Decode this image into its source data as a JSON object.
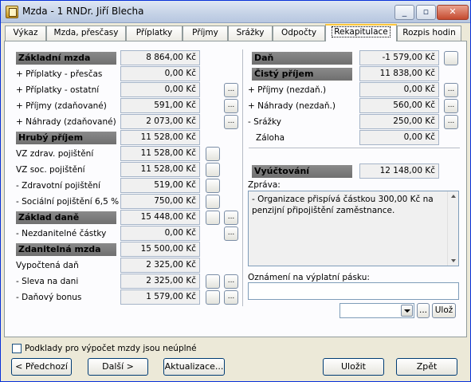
{
  "window": {
    "title": "Mzda - 1 RNDr. Jiří Blecha",
    "minimize": "_",
    "restore": "▫",
    "close": "✕"
  },
  "tabs": [
    "Výkaz",
    "Mzda, přesčasy",
    "Příplatky",
    "Příjmy",
    "Srážky",
    "Odpočty",
    "Rekapitulace",
    "Rozpis hodin"
  ],
  "active_tab": "Rekapitulace",
  "left": {
    "zakladni_mzda": {
      "label": "Základní mzda",
      "value": "8 864,00 Kč"
    },
    "priplatky_prescas": {
      "label": "+ Příplatky - přesčas",
      "value": "0,00 Kč"
    },
    "priplatky_ostatni": {
      "label": "+ Příplatky - ostatní",
      "value": "0,00 Kč"
    },
    "prijmy_zdanovane": {
      "label": "+ Příjmy (zdaňované)",
      "value": "591,00 Kč"
    },
    "nahrady_zdanovane": {
      "label": "+ Náhrady (zdaňované)",
      "value": "2 073,00 Kč"
    },
    "hruby_prijem": {
      "label": "Hrubý příjem",
      "value": "11 528,00 Kč"
    },
    "vz_zdrav": {
      "label": "VZ zdrav. pojištění",
      "value": "11 528,00 Kč"
    },
    "vz_soc": {
      "label": "VZ soc. pojištění",
      "value": "11 528,00 Kč"
    },
    "zdravotni": {
      "label": "- Zdravotní pojištění",
      "value": "519,00 Kč"
    },
    "socialni": {
      "label": "- Sociální pojištění 6,5 %",
      "value": "750,00 Kč"
    },
    "zaklad_dane": {
      "label": "Základ daně",
      "value": "15 448,00 Kč"
    },
    "nezdanitelne": {
      "label": "- Nezdanitelné částky",
      "value": "0,00 Kč"
    },
    "zdanitelna_mzda": {
      "label": "Zdanitelná mzda",
      "value": "15 500,00 Kč"
    },
    "vypoctena_dan": {
      "label": "Vypočtená daň",
      "value": "2 325,00 Kč"
    },
    "sleva_na_dani": {
      "label": "- Sleva na dani",
      "value": "2 325,00 Kč"
    },
    "danovy_bonus": {
      "label": "- Daňový bonus",
      "value": "1 579,00 Kč"
    }
  },
  "right": {
    "dan": {
      "label": "Daň",
      "value": "-1 579,00 Kč"
    },
    "cisty_prijem": {
      "label": "Čistý příjem",
      "value": "11 838,00 Kč"
    },
    "prijmy_nezdan": {
      "label": "+ Příjmy (nezdaň.)",
      "value": "0,00 Kč"
    },
    "nahrady_nezdan": {
      "label": "+ Náhrady (nezdaň.)",
      "value": "560,00 Kč"
    },
    "srazky": {
      "label": "- Srážky",
      "value": "250,00 Kč"
    },
    "zaloha": {
      "label": "Záloha",
      "value": "0,00 Kč"
    },
    "vyuctovani": {
      "label": "Vyúčtování",
      "value": "12 148,00 Kč"
    },
    "zprava_label": "Zpráva:",
    "zprava_text": "- Organizace přispívá částkou 300,00 Kč na penzijní připojištění zaměstnance.",
    "oznameni_label": "Oznámení na výplatní pásku:",
    "oznameni_value": "",
    "combo_value": ""
  },
  "buttons": {
    "ellipsis": "...",
    "uloz_small": "Ulož",
    "predchozi": "< Předchozí",
    "dalsi": "Další >",
    "aktualizace": "Aktualizace...",
    "ulozit": "Uložit",
    "zpet": "Zpět"
  },
  "checkbox": {
    "label": "Podklady pro výpočet mzdy jsou neúplné",
    "checked": false
  }
}
